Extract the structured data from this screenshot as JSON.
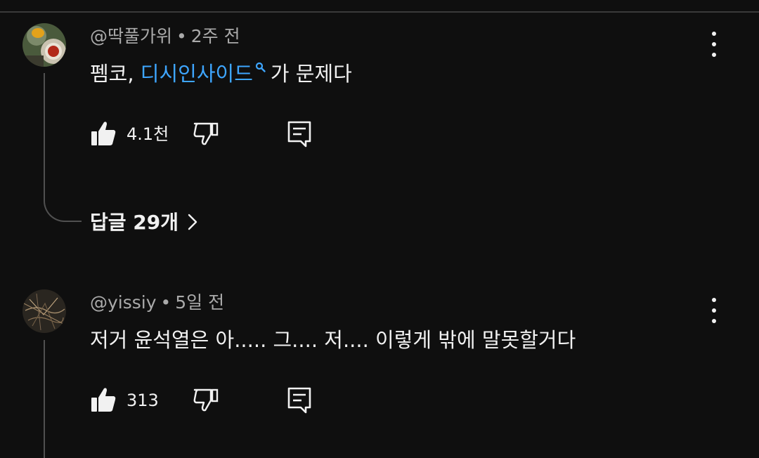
{
  "comments": [
    {
      "author": "@딱풀가위",
      "separator": "•",
      "time": "2주 전",
      "text_before": "펨코, ",
      "mention": "디시인사이드",
      "text_after": "가 문제다",
      "likes": "4.1천",
      "replies_label": "답글 29개"
    },
    {
      "author": "@yissiy",
      "separator": "•",
      "time": "5일 전",
      "text": "저거 윤석열은 아..... 그.... 저.... 이렇게 밖에 말못할거다",
      "likes": "313"
    }
  ],
  "icons": {
    "like": "thumbs-up-icon",
    "dislike": "thumbs-down-icon",
    "reply": "reply-comment-icon",
    "more": "more-vertical-icon",
    "search": "search-icon",
    "chevron": "chevron-right-icon"
  },
  "colors": {
    "background": "#0f0f0f",
    "text": "#f1f1f1",
    "secondary_text": "#aaaaaa",
    "link": "#3ea6ff"
  }
}
